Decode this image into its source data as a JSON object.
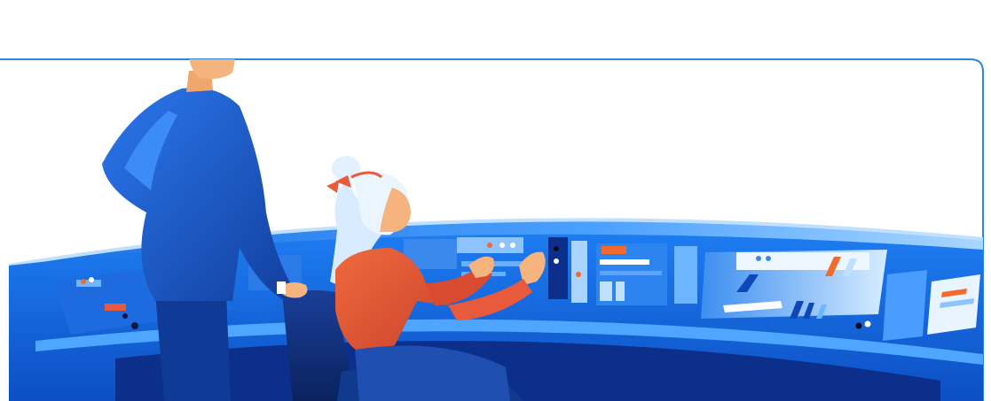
{
  "scene": {
    "palette": {
      "frame_stroke": "#2f86d8",
      "console_deep": "#0b2f8a",
      "console_mid": "#1565d8",
      "console_light": "#8fc6ff",
      "accent_orange": "#f26a2e",
      "man_suit": "#1d5fd6",
      "man_hair": "#e2541f",
      "skin": "#f5b37d",
      "woman_shirt": "#e85a3c",
      "woman_hair": "#d9ecff"
    },
    "panel_lights": [
      "orange",
      "white",
      "blue",
      "black"
    ]
  }
}
